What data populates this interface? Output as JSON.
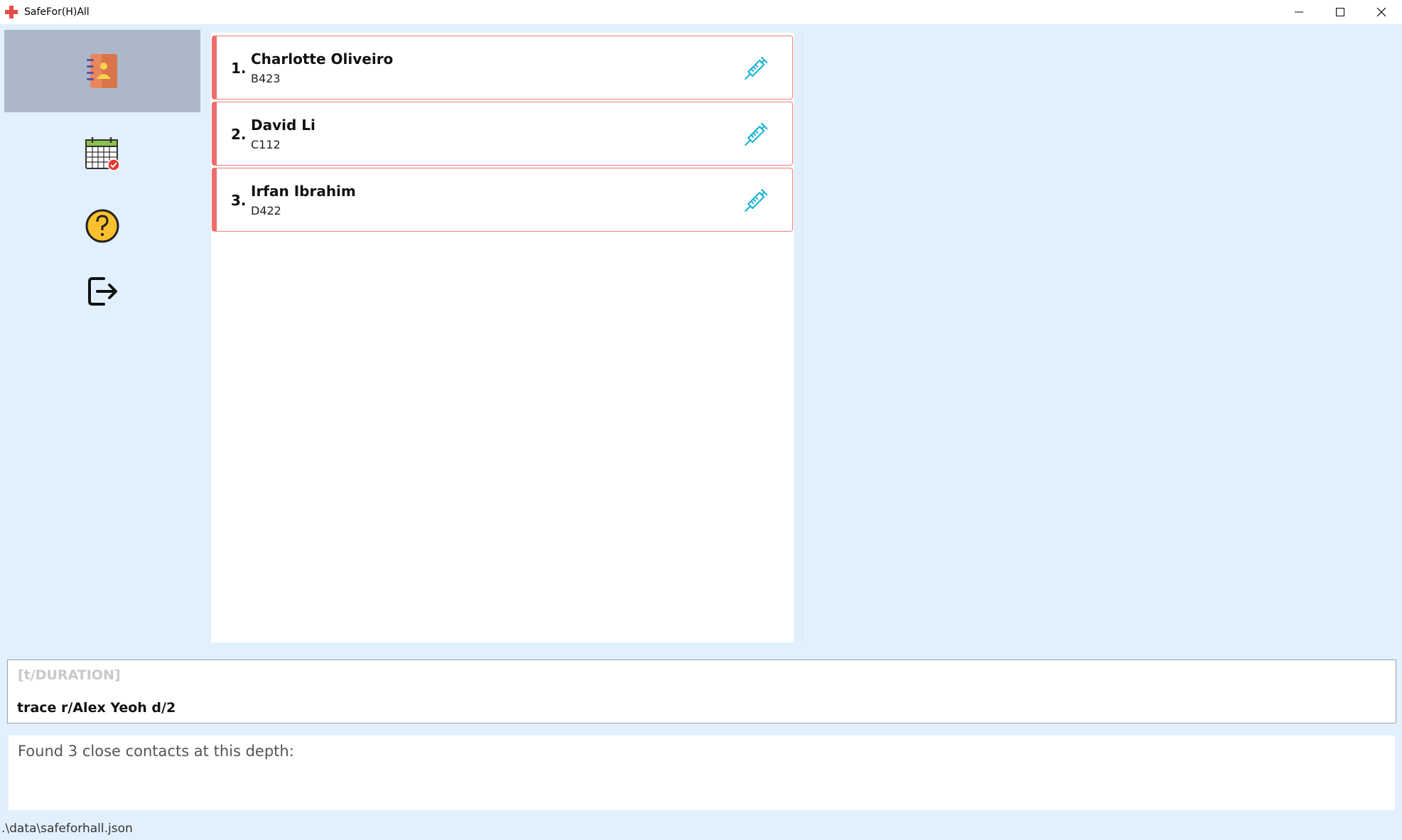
{
  "window": {
    "title": "SafeFor(H)All"
  },
  "sidebar": {
    "items": [
      {
        "name": "contacts",
        "icon": "address-book-icon",
        "active": true
      },
      {
        "name": "events",
        "icon": "calendar-icon",
        "active": false
      },
      {
        "name": "help",
        "icon": "question-icon",
        "active": false
      },
      {
        "name": "exit",
        "icon": "exit-icon",
        "active": false
      }
    ]
  },
  "residents": [
    {
      "index": "1.",
      "name": "Charlotte Oliveiro",
      "room": "B423",
      "vaccinated": true
    },
    {
      "index": "2.",
      "name": "David Li",
      "room": "C112",
      "vaccinated": true
    },
    {
      "index": "3.",
      "name": "Irfan Ibrahim",
      "room": "D422",
      "vaccinated": true
    }
  ],
  "command": {
    "hint": "[t/DURATION]",
    "value": "trace r/Alex Yeoh d/2"
  },
  "result": {
    "message": "Found 3 close contacts at this depth:"
  },
  "status": {
    "file_path": ".\\data\\safeforhall.json"
  },
  "colors": {
    "background": "#e2f0fd",
    "sidebar_active": "#acb8c9",
    "card_border": "#f06b6b",
    "vaccine_icon": "#1fb5d6"
  }
}
